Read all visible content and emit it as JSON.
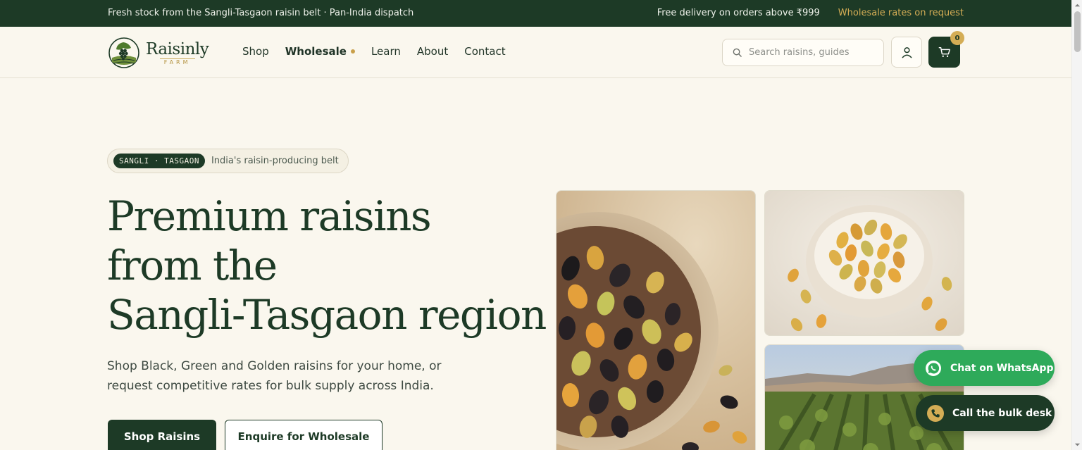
{
  "announcement": {
    "left_text": "Fresh stock from the Sangli-Tasgaon raisin belt · Pan-India dispatch",
    "delivery_text": "Free delivery on orders above ₹999",
    "wholesale_link": "Wholesale rates on request"
  },
  "brand": {
    "name": "Raisinly",
    "sub": "FARM",
    "logo_icon": "grape-leaf-icon"
  },
  "nav": {
    "items": [
      {
        "label": "Shop"
      },
      {
        "label": "Wholesale"
      },
      {
        "label": "Learn"
      },
      {
        "label": "About"
      },
      {
        "label": "Contact"
      }
    ]
  },
  "search": {
    "placeholder": "Search raisins, guides",
    "value": ""
  },
  "cart": {
    "count": "0"
  },
  "hero": {
    "tag": "SANGLI · TASGAON",
    "tag_caption": "India's raisin-producing belt",
    "headline": [
      "Premium raisins",
      "from the",
      "Sangli-Tasgaon region"
    ],
    "subtext": "Shop Black, Green and Golden raisins for your home, or request competitive rates for bulk supply across India.",
    "primary_cta": "Shop Raisins",
    "secondary_cta": "Enquire for Wholesale"
  },
  "floating": {
    "whatsapp": "Chat on WhatsApp",
    "call": "Call the bulk desk"
  },
  "colors": {
    "brand_green": "#1d3a26",
    "accent_gold": "#d4ad55",
    "whatsapp_green": "#2eaa5a",
    "background": "#faf7ee"
  }
}
